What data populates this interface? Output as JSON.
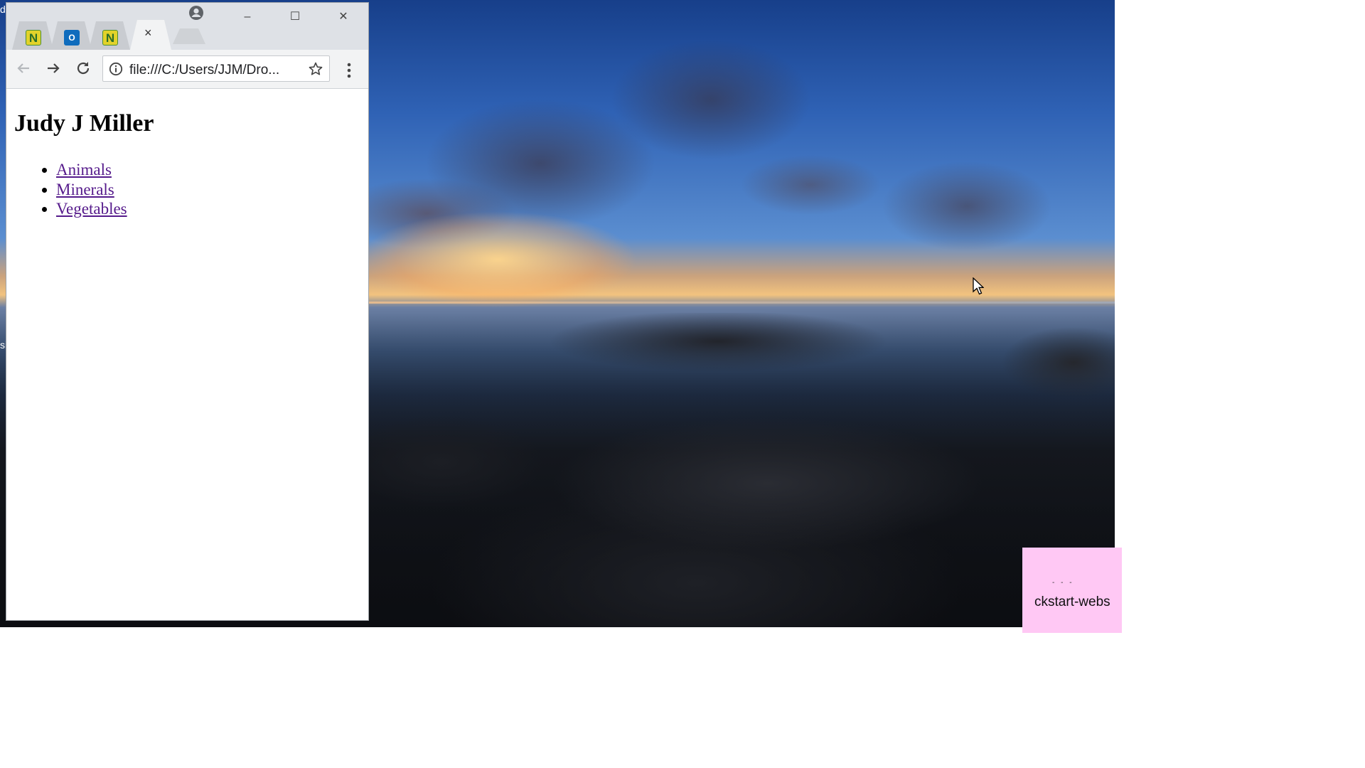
{
  "browser": {
    "tabs": [
      {
        "favicon": "N",
        "icon": "onenote-n-icon"
      },
      {
        "favicon": "O",
        "icon": "outlook-icon"
      },
      {
        "favicon": "N",
        "icon": "onenote-n-icon"
      },
      {
        "close": "×",
        "active": true
      }
    ],
    "address": {
      "url": "file:///C:/Users/JJM/Dro..."
    },
    "window_controls": {
      "minimize": "–",
      "maximize": "☐",
      "close": "✕"
    }
  },
  "page": {
    "heading": "Judy J Miller",
    "links": [
      "Animals",
      "Minerals",
      "Vegetables"
    ],
    "link_color": "#551a8b"
  },
  "desktop": {
    "edge_text": [
      "d",
      "si"
    ],
    "notification": {
      "text": "ckstart-webs",
      "dots": "- - -"
    }
  }
}
